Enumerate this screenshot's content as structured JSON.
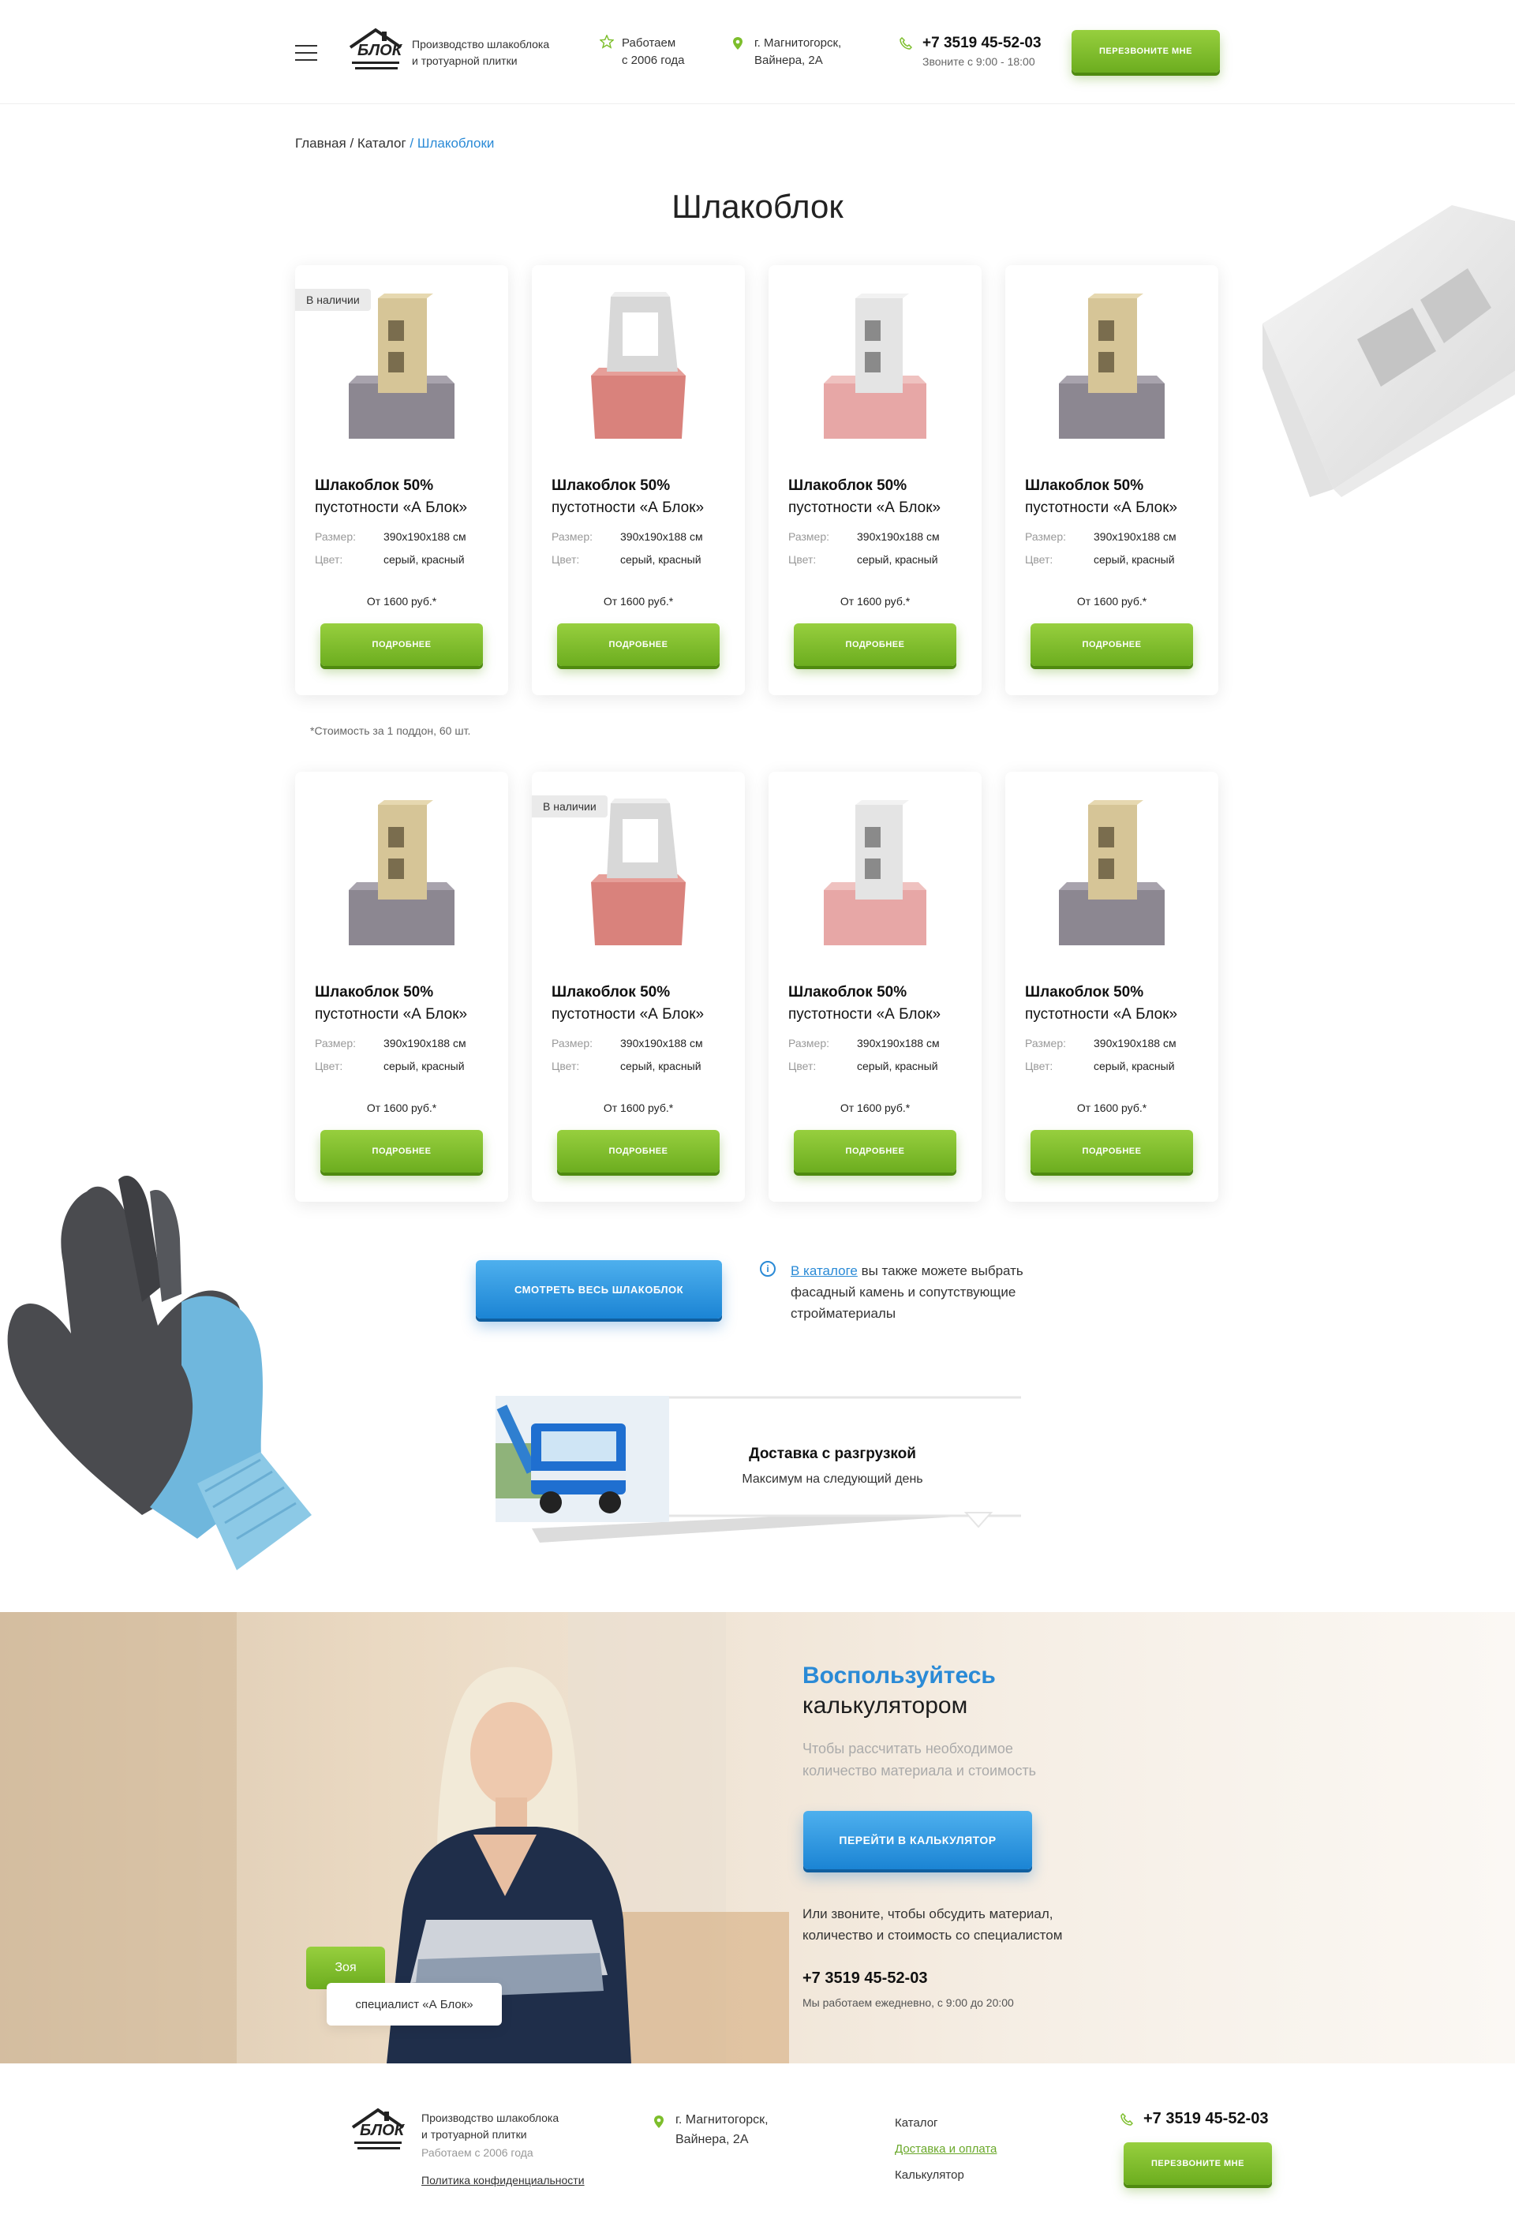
{
  "header": {
    "logo_text": "БЛОК",
    "tagline_1": "Производство шлакоблока",
    "tagline_2": "и тротуарной плитки",
    "since_1": "Работаем",
    "since_2": "с 2006 года",
    "address_1": "г. Магнитогорск,",
    "address_2": "Вайнера, 2А",
    "phone": "+7 3519 45-52-03",
    "phone_hours": "Звоните с 9:00 - 18:00",
    "callback_label": "Перезвоните мне"
  },
  "breadcrumbs": {
    "home": "Главная",
    "sep1": " / ",
    "catalog": "Каталог",
    "sep2": " / ",
    "current": "Шлакоблоки"
  },
  "page_title": "Шлакоблок",
  "product_labels": {
    "size_label": "Размер:",
    "color_label": "Цвет:",
    "details_label": "Подробнее"
  },
  "products_row1": [
    {
      "badge": "В наличии",
      "title_bold": "Шлакоблок 50%",
      "title_rest": "пустотности «А Блок»",
      "size": "390х190х188 см",
      "color": "серый, красный",
      "price": "От 1600 руб.*",
      "image": "yellow-block-icon"
    },
    {
      "badge": "",
      "title_bold": "Шлакоблок 50%",
      "title_rest": "пустотности «А Блок»",
      "size": "390х190х188 см",
      "color": "серый, красный",
      "price": "От 1600 руб.*",
      "image": "white-frame-block-icon"
    },
    {
      "badge": "",
      "title_bold": "Шлакоблок 50%",
      "title_rest": "пустотности «А Блок»",
      "size": "390х190х188 см",
      "color": "серый, красный",
      "price": "От 1600 руб.*",
      "image": "white-pink-block-icon"
    },
    {
      "badge": "",
      "title_bold": "Шлакоблок 50%",
      "title_rest": "пустотности «А Блок»",
      "size": "390х190х188 см",
      "color": "серый, красный",
      "price": "От 1600 руб.*",
      "image": "yellow-block-icon"
    }
  ],
  "price_note": "*Стоимость за 1 поддон, 60 шт.",
  "products_row2": [
    {
      "badge": "",
      "title_bold": "Шлакоблок 50%",
      "title_rest": "пустотности «А Блок»",
      "size": "390х190х188 см",
      "color": "серый, красный",
      "price": "От 1600 руб.*",
      "image": "yellow-block-icon"
    },
    {
      "badge": "В наличии",
      "title_bold": "Шлакоблок 50%",
      "title_rest": "пустотности «А Блок»",
      "size": "390х190х188 см",
      "color": "серый, красный",
      "price": "От 1600 руб.*",
      "image": "white-frame-block-icon"
    },
    {
      "badge": "",
      "title_bold": "Шлакоблок 50%",
      "title_rest": "пустотности «А Блок»",
      "size": "390х190х188 см",
      "color": "серый, красный",
      "price": "От 1600 руб.*",
      "image": "white-pink-block-icon"
    },
    {
      "badge": "",
      "title_bold": "Шлакоблок 50%",
      "title_rest": "пустотности «А Блок»",
      "size": "390х190х188 см",
      "color": "серый, красный",
      "price": "От 1600 руб.*",
      "image": "yellow-block-icon"
    }
  ],
  "view_all_label": "Смотреть весь шлакоблок",
  "catalog_info": {
    "link": "В каталоге",
    "text": " вы также можете выбрать фасадный камень и сопутствующие стройматериалы"
  },
  "delivery": {
    "title": "Доставка с разгрузкой",
    "subtitle": "Максимум на следующий день"
  },
  "calculator": {
    "title_blue": "Воспользуйтесь",
    "title_rest": "калькулятором",
    "subtitle": "Чтобы рассчитать необходимое количество материала и стоимость",
    "button": "Перейти в калькулятор",
    "call_text": "Или звоните, чтобы обсудить материал, количество и стоимость со специалистом",
    "phone": "+7 3519 45-52-03",
    "hours": "Мы работаем ежедневно, с 9:00 до 20:00",
    "person_name": "Зоя",
    "person_role": "специалист «А Блок»"
  },
  "footer": {
    "logo_text": "БЛОК",
    "tagline_1": "Производство шлакоблока",
    "tagline_2": "и тротуарной плитки",
    "since": "Работаем с 2006 года",
    "privacy": "Политика конфиденциальности",
    "address_1": "г. Магнитогорск,",
    "address_2": "Вайнера, 2А",
    "nav": [
      "Каталог",
      "Доставка и оплата",
      "Калькулятор"
    ],
    "phone": "+7 3519 45-52-03",
    "callback_label": "Перезвоните мне"
  },
  "colors": {
    "green": "#7dbe2c",
    "blue": "#2a8ad6"
  }
}
